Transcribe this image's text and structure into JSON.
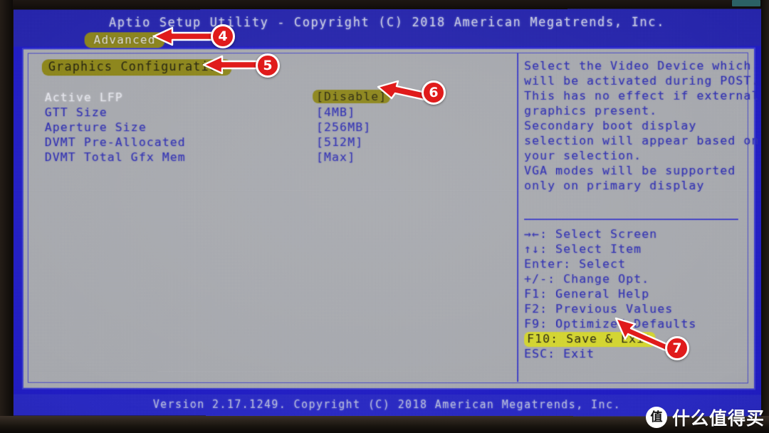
{
  "bios": {
    "title": "Aptio Setup Utility - Copyright (C) 2018 American Megatrends, Inc.",
    "active_tab": "Advanced",
    "footer": "Version 2.17.1249. Copyright (C) 2018 American Megatrends, Inc.",
    "section_title": "Graphics Configuration",
    "options": [
      {
        "label": "Active LFP",
        "value": "[Disable]",
        "selected": true,
        "highlighted": true
      },
      {
        "label": "GTT Size",
        "value": "[4MB]",
        "selected": false,
        "highlighted": false
      },
      {
        "label": "Aperture Size",
        "value": "[256MB]",
        "selected": false,
        "highlighted": false
      },
      {
        "label": "DVMT Pre-Allocated",
        "value": "[512M]",
        "selected": false,
        "highlighted": false
      },
      {
        "label": "DVMT Total Gfx Mem",
        "value": "[Max]",
        "selected": false,
        "highlighted": false
      }
    ],
    "help_lines": [
      "Select the Video Device which",
      "will be activated during POST.",
      "This has no effect if external",
      "graphics present.",
      "Secondary boot display",
      "selection will appear based on",
      "your selection.",
      "VGA modes will be supported",
      "only on primary display"
    ],
    "key_legend": [
      {
        "text": "→←: Select Screen",
        "highlighted": false
      },
      {
        "text": "↑↓: Select Item",
        "highlighted": false
      },
      {
        "text": "Enter: Select",
        "highlighted": false
      },
      {
        "text": "+/-: Change Opt.",
        "highlighted": false
      },
      {
        "text": "F1: General Help",
        "highlighted": false
      },
      {
        "text": "F2: Previous Values",
        "highlighted": false
      },
      {
        "text": "F9: Optimized Defaults",
        "highlighted": false
      },
      {
        "text": "F10: Save & Exit",
        "highlighted": true
      },
      {
        "text": "ESC: Exit",
        "highlighted": false
      }
    ]
  },
  "annotations": [
    {
      "number": "4",
      "target": "advanced-tab"
    },
    {
      "number": "5",
      "target": "graphics-configuration-title"
    },
    {
      "number": "6",
      "target": "active-lfp-value"
    },
    {
      "number": "7",
      "target": "f10-save-and-exit"
    }
  ],
  "watermark": {
    "badge": "值",
    "text": "什么值得买"
  },
  "colors": {
    "header_blue": "#201fae",
    "footer_blue": "#2323c6",
    "panel_grey": "#a9abb1",
    "text_blue": "#2b2bb4",
    "highlight_olive": "#8d8614",
    "highlight_yellow": "#d8da2a",
    "marker_red": "#e01b1b"
  }
}
